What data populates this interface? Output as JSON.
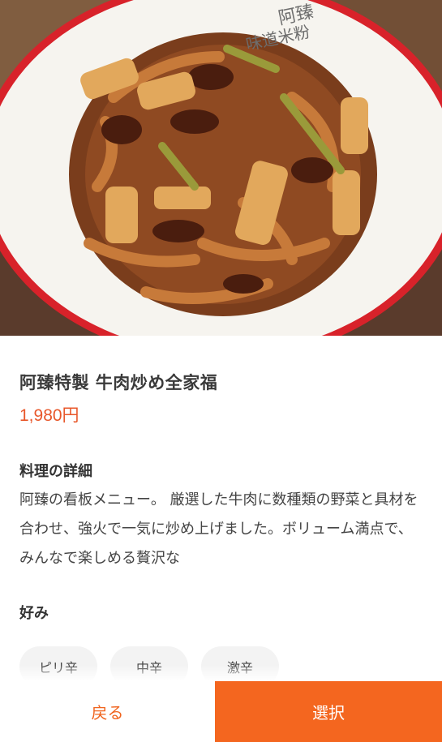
{
  "product": {
    "image_alt": "牛肉炒め全家福",
    "plate_text": "阿臻 味道米粉",
    "title": "阿臻特製 牛肉炒め全家福",
    "price": "1,980円"
  },
  "details": {
    "label": "料理の詳細",
    "description": "阿臻の看板メニュー。 厳選した牛肉に数種類の野菜と具材を合わせ、強火で一気に炒め上げました。ボリューム満点で、みんなで楽しめる贅沢な"
  },
  "preference": {
    "label": "好み",
    "options": [
      "ピリ辛",
      "中辛",
      "激辛"
    ]
  },
  "footer": {
    "back_label": "戻る",
    "select_label": "選択"
  },
  "colors": {
    "accent": "#f4661f",
    "price": "#e8572a"
  }
}
